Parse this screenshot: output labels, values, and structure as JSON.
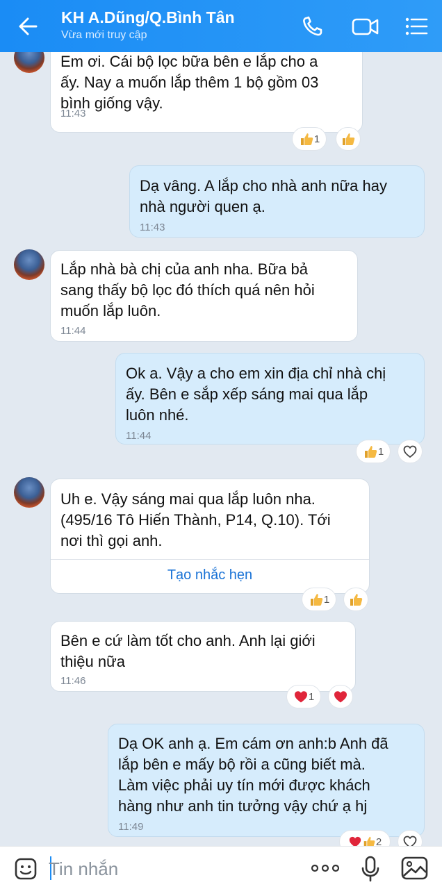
{
  "header": {
    "title": "KH A.Dũng/Q.Bình Tân",
    "subtitle": "Vừa mới truy cập"
  },
  "messages": [
    {
      "direction": "in",
      "text": "Em ơi. Cái bộ lọc bữa bên e lắp cho a\nấy. Nay a muốn lắp thêm 1 bộ gồm 03\nbình giống vậy.",
      "time": "11:43",
      "reaction": {
        "icon": "thumbs-up-icon",
        "count": "1"
      }
    },
    {
      "direction": "out",
      "text": "Dạ vâng. A lắp cho nhà anh nữa hay\nnhà người quen ạ.",
      "time": "11:43"
    },
    {
      "direction": "in",
      "text": "Lắp nhà bà chị của anh nha. Bữa bả\nsang thấy bộ lọc đó thích quá nên hỏi\nmuốn lắp luôn.",
      "time": "11:44"
    },
    {
      "direction": "out",
      "text": "Ok a. Vậy a cho em xin địa chỉ nhà chị\nấy. Bên e sắp xếp sáng mai qua lắp\nluôn nhé.",
      "time": "11:44",
      "reaction": {
        "icon": "thumbs-up-icon",
        "count": "1"
      }
    },
    {
      "direction": "in",
      "text": "Uh e. Vậy sáng mai qua lắp luôn nha.\n(495/16 Tô Hiến Thành, P14, Q.10). Tới\nnơi thì gọi anh.",
      "action": "Tạo nhắc hẹn",
      "reaction": {
        "icon": "thumbs-up-icon",
        "count": "1"
      }
    },
    {
      "direction": "in",
      "text": "Bên e cứ làm tốt cho anh. Anh lại giới\nthiệu nữa",
      "time": "11:46",
      "reaction": {
        "icon": "heart-icon",
        "count": "1"
      }
    },
    {
      "direction": "out",
      "text": "Dạ OK anh ạ. Em cám ơn anh:b Anh đã\nlắp bên e mấy bộ rồi a cũng biết mà.\nLàm việc phải uy tín mới được khách\nhàng như anh tin tưởng vậy chứ ạ hj",
      "time": "11:49",
      "reaction": {
        "icon": "heart-thumbs-icon",
        "count": "2"
      }
    }
  ],
  "composer": {
    "placeholder": "Tin nhắn"
  },
  "colors": {
    "header": "#1a8cf5",
    "background": "#e2e9f1",
    "incoming_bubble": "#ffffff",
    "outgoing_bubble": "#d6ecfc",
    "link": "#1a73d6",
    "heart": "#e0253a",
    "thumb": "#f2b33d"
  }
}
